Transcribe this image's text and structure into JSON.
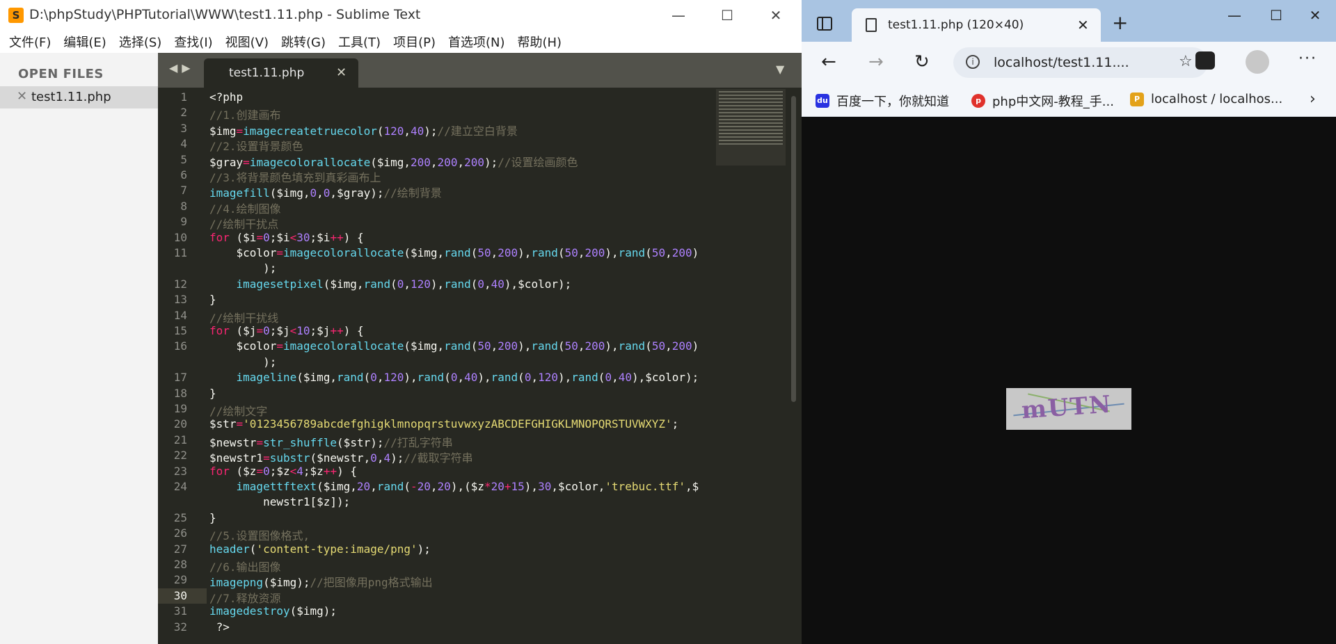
{
  "sublime": {
    "title": "D:\\phpStudy\\PHPTutorial\\WWW\\test1.11.php - Sublime Text",
    "menu": [
      "文件(F)",
      "编辑(E)",
      "选择(S)",
      "查找(I)",
      "视图(V)",
      "跳转(G)",
      "工具(T)",
      "项目(P)",
      "首选项(N)",
      "帮助(H)"
    ],
    "sidebar_header": "OPEN FILES",
    "open_file": "test1.11.php",
    "tab_name": "test1.11.php",
    "current_line": 30
  },
  "edge": {
    "tab_title": "test1.11.php (120×40)",
    "url": "localhost/test1.11....",
    "bookmarks": [
      {
        "label": "百度一下，你就知道",
        "color": "#2932e1",
        "icon": "baidu-icon"
      },
      {
        "label": "php中文网-教程_手...",
        "color": "#e0322c",
        "icon": "php-icon"
      },
      {
        "label": "localhost / localhos...",
        "color": "#e3a21a",
        "icon": "phpmyadmin-icon"
      }
    ],
    "captcha_text": "mUTN"
  }
}
